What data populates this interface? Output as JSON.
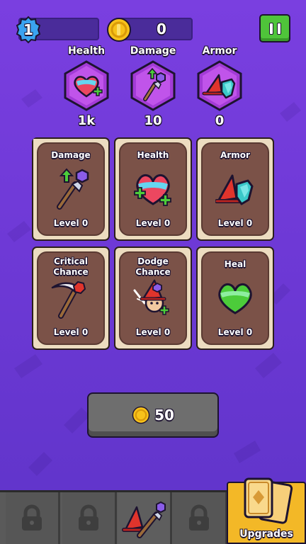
{
  "player": {
    "level": "1",
    "coins": "0"
  },
  "stats": [
    {
      "label": "Health",
      "value": "1k",
      "icon": "heart-icon"
    },
    {
      "label": "Damage",
      "value": "10",
      "icon": "staff-icon"
    },
    {
      "label": "Armor",
      "value": "0",
      "icon": "armor-icon"
    }
  ],
  "cards": [
    {
      "title": "Damage",
      "level": "Level 0",
      "icon": "staff-icon"
    },
    {
      "title": "Health",
      "level": "Level 0",
      "icon": "heart-icon"
    },
    {
      "title": "Armor",
      "level": "Level 0",
      "icon": "armor-icon"
    },
    {
      "title": "Critical Chance",
      "title1": "Critical",
      "title2": "Chance",
      "level": "Level 0",
      "icon": "scythe-icon"
    },
    {
      "title": "Dodge Chance",
      "title1": "Dodge",
      "title2": "Chance",
      "level": "Level 0",
      "icon": "wizard-icon"
    },
    {
      "title": "Heal",
      "level": "Level 0",
      "icon": "green-heart-icon"
    }
  ],
  "buy": {
    "cost": "50"
  },
  "nav": {
    "tabs": [
      {
        "name": "locked",
        "icon": "lock-icon"
      },
      {
        "name": "locked",
        "icon": "lock-icon"
      },
      {
        "name": "hero",
        "icon": "wizard-hat-staff-icon"
      },
      {
        "name": "locked",
        "icon": "lock-icon"
      }
    ],
    "upgrades_label": "Upgrades"
  },
  "colors": {
    "background": "#7a3fe0",
    "card_frame": "#ecdcc0",
    "card_inner": "#7b5248",
    "stat_hex": "#a33bd6",
    "pause_button": "#4fc43a",
    "upgrades_tab": "#f3b827",
    "coin": "#f7c21a"
  }
}
